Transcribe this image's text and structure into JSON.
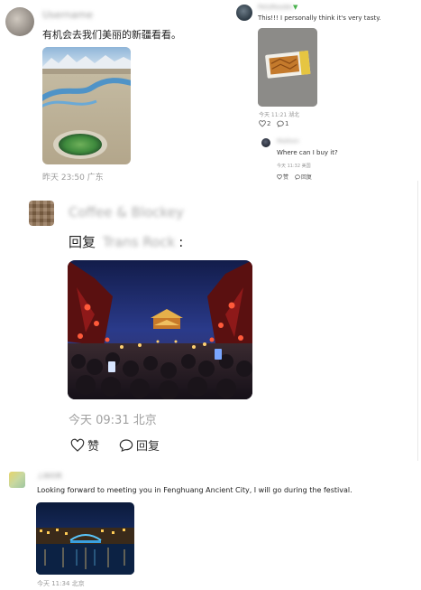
{
  "comment1": {
    "username": "Username",
    "text": "有机会去我们美丽的新疆看看。",
    "meta": "昨天 23:50 广东"
  },
  "comment2": {
    "username": "PetsReader",
    "text": "This!!! I personally think it's very tasty.",
    "meta": "今天 11:21 湖北",
    "like_count": "2",
    "reply_count": "1"
  },
  "comment3": {
    "username": "Madison",
    "text": "Where can I buy it?",
    "meta": "今天 11:32 美国",
    "like_label": "赞",
    "reply_label": "回复"
  },
  "comment4": {
    "username": "Coffee & Blockey",
    "reply_prefix": "回复",
    "reply_target": "Trans Rock",
    "reply_colon": ":",
    "meta": "今天 09:31 北京",
    "like_label": "赞",
    "reply_label": "回复"
  },
  "comment5": {
    "username": "上岸的熊",
    "text": "Looking forward to meeting you in Fenghuang Ancient City, I will go during the festival.",
    "meta": "今天 11:34 北京"
  },
  "colors": {
    "meta_gray": "#9a9a9a",
    "text_dark": "#222222"
  },
  "icons": {
    "like": "heart-outline-icon",
    "reply": "speech-bubble-icon"
  }
}
